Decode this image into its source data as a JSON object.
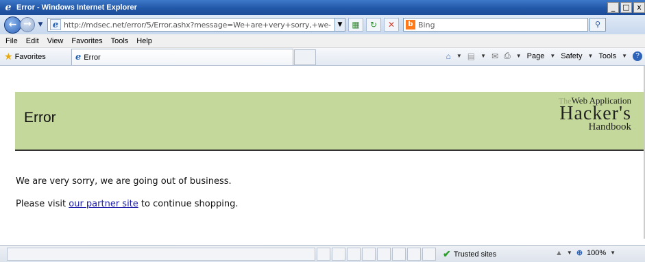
{
  "window": {
    "title": "Error - Windows Internet Explorer",
    "min_label": "_",
    "max_label": "□",
    "close_label": "x"
  },
  "address": {
    "url": "http://mdsec.net/error/5/Error.ashx?message=We+are+very+sorry,+we-"
  },
  "search": {
    "placeholder": "Bing"
  },
  "menu": [
    "File",
    "Edit",
    "View",
    "Favorites",
    "Tools",
    "Help"
  ],
  "favorites": {
    "label": "Favorites",
    "tab_label": "Error"
  },
  "commandbar": {
    "page": "Page",
    "safety": "Safety",
    "tools": "Tools"
  },
  "page": {
    "header_title": "Error",
    "logo_the": "The",
    "logo_line1": "Web Application",
    "logo_line2": "Hacker's",
    "logo_line3": "Handbook",
    "line1": "We are very sorry, we are going out of business.",
    "line2_before": "Please visit ",
    "line2_link": "our partner site",
    "line2_after": " to continue shopping."
  },
  "status": {
    "zone": "Trusted sites",
    "zoom": "100%"
  },
  "colors": {
    "header_bg": "#c4d89c",
    "link": "#1a1aa6",
    "titlebar": "#2358a8"
  }
}
